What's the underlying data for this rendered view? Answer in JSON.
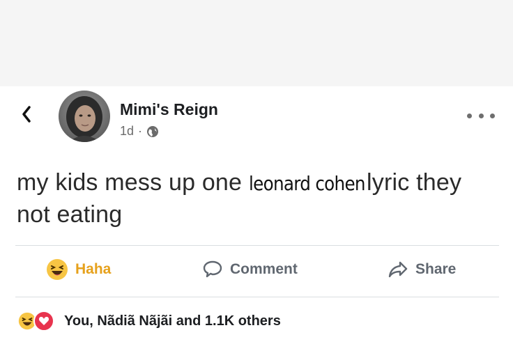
{
  "post": {
    "author": "Mimi's Reign",
    "timestamp": "1d",
    "meta_separator": "·",
    "privacy_icon": "globe-icon",
    "text_before": "my kids mess up one ",
    "text_insert": "leonard cohen",
    "text_after": " lyric they not eating"
  },
  "actions": {
    "haha_label": "Haha",
    "comment_label": "Comment",
    "share_label": "Share"
  },
  "reactions": {
    "summary": "You, Nãdiã Nãjãi and 1.1K others",
    "icons": [
      "haha-emoji-icon",
      "love-heart-icon"
    ]
  },
  "colors": {
    "haha_accent": "#e6a11c",
    "love_red": "#e8344e",
    "muted_text": "#606770",
    "divider": "#dadde1"
  }
}
